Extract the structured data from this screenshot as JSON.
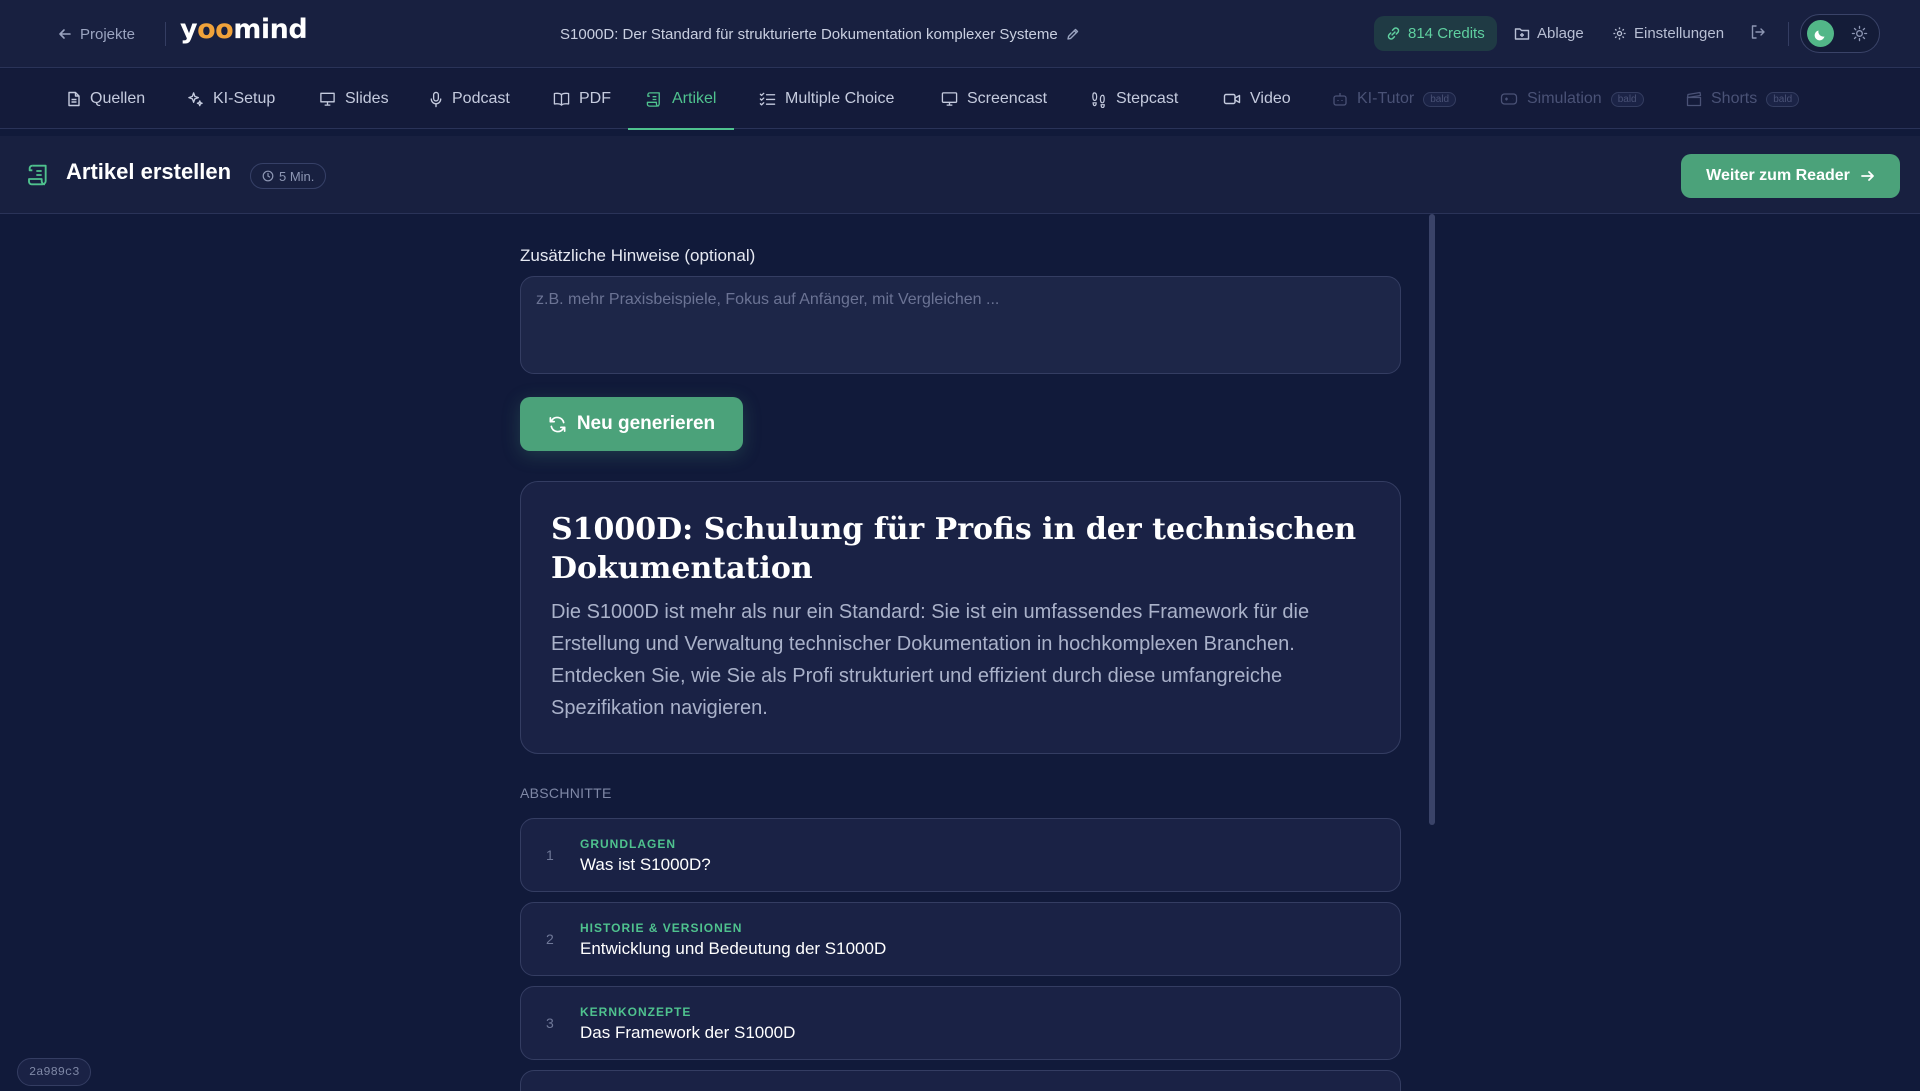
{
  "topbar": {
    "back_label": "Projekte",
    "logo_text_1": "y",
    "logo_text_oo": "oo",
    "logo_text_2": "mind",
    "project_title": "S1000D: Der Standard für strukturierte Dokumentation komplexer Systeme",
    "credits": "814 Credits",
    "archive_label": "Ablage",
    "settings_label": "Einstellungen"
  },
  "tabs": [
    {
      "label": "Quellen"
    },
    {
      "label": "KI-Setup"
    },
    {
      "label": "Slides"
    },
    {
      "label": "Podcast"
    },
    {
      "label": "PDF"
    },
    {
      "label": "Artikel"
    },
    {
      "label": "Multiple Choice"
    },
    {
      "label": "Screencast"
    },
    {
      "label": "Stepcast"
    },
    {
      "label": "Video"
    },
    {
      "label": "KI-Tutor",
      "badge": "bald"
    },
    {
      "label": "Simulation",
      "badge": "bald"
    },
    {
      "label": "Shorts",
      "badge": "bald"
    }
  ],
  "header": {
    "title": "Artikel erstellen",
    "duration": "5 Min.",
    "reader_button": "Weiter zum Reader"
  },
  "form": {
    "notes_label": "Zusätzliche Hinweise (optional)",
    "notes_placeholder": "z.B. mehr Praxisbeispiele, Fokus auf Anfänger, mit Vergleichen ...",
    "notes_value": "",
    "regenerate_button": "Neu generieren"
  },
  "article": {
    "title": "S1000D: Schulung für Profis in der technischen Dokumentation",
    "description": "Die S1000D ist mehr als nur ein Standard: Sie ist ein umfassendes Framework für die Erstellung und Verwaltung technischer Dokumentation in hochkomplexen Branchen. Entdecken Sie, wie Sie als Profi strukturiert und effizient durch diese umfangreiche Spezifikation navigieren."
  },
  "sections": {
    "label": "ABSCHNITTE",
    "items": [
      {
        "num": "1",
        "category": "GRUNDLAGEN",
        "title": "Was ist S1000D?"
      },
      {
        "num": "2",
        "category": "HISTORIE & VERSIONEN",
        "title": "Entwicklung und Bedeutung der S1000D"
      },
      {
        "num": "3",
        "category": "KERNKONZEPTE",
        "title": "Das Framework der S1000D"
      }
    ]
  },
  "build_id": "2a989c3",
  "colors": {
    "accent": "#4fc28e",
    "button": "#4ba27a",
    "background": "#111a3a"
  }
}
